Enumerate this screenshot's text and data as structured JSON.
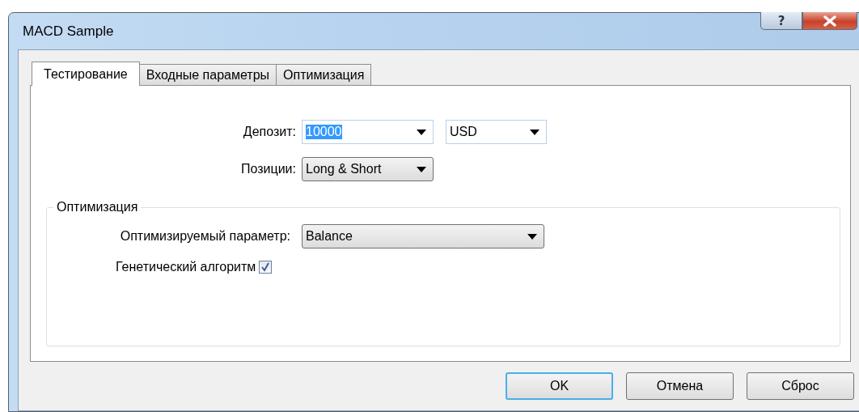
{
  "window": {
    "title": "MACD Sample",
    "help_button": "?"
  },
  "tabs": [
    {
      "label": "Тестирование",
      "selected": true
    },
    {
      "label": "Входные параметры",
      "selected": false
    },
    {
      "label": "Оптимизация",
      "selected": false
    }
  ],
  "fields": [
    {
      "label": "Депозит:",
      "kind": "editable",
      "value": "10000",
      "highlighted": true,
      "extra": {
        "kind": "editable",
        "value": "USD"
      }
    },
    {
      "label": "Позиции:",
      "kind": "list",
      "value": "Long & Short"
    }
  ],
  "optimization": {
    "legend": "Оптимизация",
    "parameter": {
      "label": "Оптимизируемый параметр:",
      "kind": "list",
      "value": "Balance"
    },
    "genetic": {
      "label": "Генетический алгоритм",
      "checked": true
    }
  },
  "buttons": [
    {
      "label": "OK",
      "default": true
    },
    {
      "label": "Отмена",
      "default": false
    },
    {
      "label": "Сброс",
      "default": false
    }
  ]
}
